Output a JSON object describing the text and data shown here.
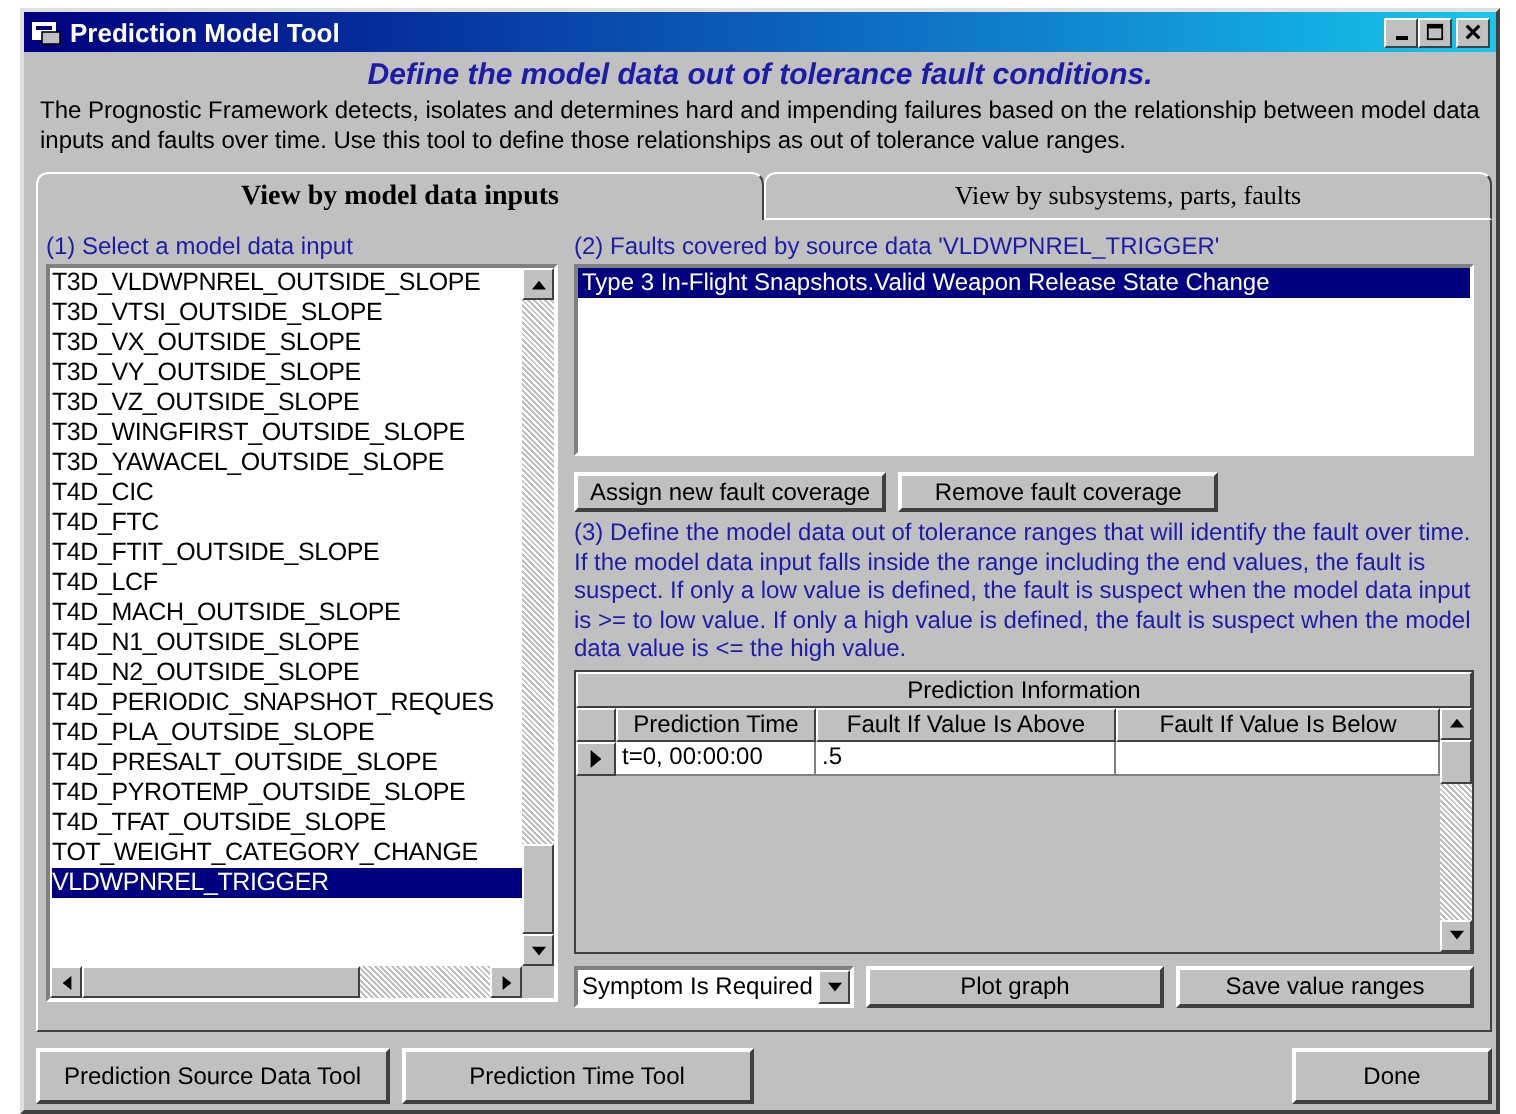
{
  "window": {
    "title": "Prediction Model Tool"
  },
  "heading": "Define the model data out of tolerance fault conditions.",
  "description": "The Prognostic Framework detects, isolates and determines hard and impending failures based on the relationship between model data inputs and faults over time.  Use this tool to define those relationships as out of tolerance value ranges.",
  "tabs": [
    {
      "label": "View by model data inputs",
      "selected": true
    },
    {
      "label": "View by subsystems, parts, faults",
      "selected": false
    }
  ],
  "inputs_panel": {
    "label": "(1) Select a model data input",
    "items": [
      {
        "label": "T3D_VLDWPNREL_OUTSIDE_SLOPE",
        "selected": false
      },
      {
        "label": "T3D_VTSI_OUTSIDE_SLOPE",
        "selected": false
      },
      {
        "label": "T3D_VX_OUTSIDE_SLOPE",
        "selected": false
      },
      {
        "label": "T3D_VY_OUTSIDE_SLOPE",
        "selected": false
      },
      {
        "label": "T3D_VZ_OUTSIDE_SLOPE",
        "selected": false
      },
      {
        "label": "T3D_WINGFIRST_OUTSIDE_SLOPE",
        "selected": false
      },
      {
        "label": "T3D_YAWACEL_OUTSIDE_SLOPE",
        "selected": false
      },
      {
        "label": "T4D_CIC",
        "selected": false
      },
      {
        "label": "T4D_FTC",
        "selected": false
      },
      {
        "label": "T4D_FTIT_OUTSIDE_SLOPE",
        "selected": false
      },
      {
        "label": "T4D_LCF",
        "selected": false
      },
      {
        "label": "T4D_MACH_OUTSIDE_SLOPE",
        "selected": false
      },
      {
        "label": "T4D_N1_OUTSIDE_SLOPE",
        "selected": false
      },
      {
        "label": "T4D_N2_OUTSIDE_SLOPE",
        "selected": false
      },
      {
        "label": "T4D_PERIODIC_SNAPSHOT_REQUES",
        "selected": false
      },
      {
        "label": "T4D_PLA_OUTSIDE_SLOPE",
        "selected": false
      },
      {
        "label": "T4D_PRESALT_OUTSIDE_SLOPE",
        "selected": false
      },
      {
        "label": "T4D_PYROTEMP_OUTSIDE_SLOPE",
        "selected": false
      },
      {
        "label": "T4D_TFAT_OUTSIDE_SLOPE",
        "selected": false
      },
      {
        "label": "TOT_WEIGHT_CATEGORY_CHANGE",
        "selected": false
      },
      {
        "label": "VLDWPNREL_TRIGGER",
        "selected": true
      }
    ]
  },
  "faults_panel": {
    "label": "(2) Faults covered by source data 'VLDWPNREL_TRIGGER'",
    "items": [
      {
        "label": "Type 3 In-Flight Snapshots.Valid Weapon Release State Change",
        "selected": true
      }
    ]
  },
  "coverage_buttons": [
    "Assign new fault coverage",
    "Remove fault coverage"
  ],
  "instructions": "(3) Define the model data out of tolerance ranges that will identify the fault over time.  If the model data input falls inside the range including the end values, the fault is suspect. If only a low value is defined, the fault is suspect when the model data input is >= to low value.  If only a high value is defined, the fault is suspect when the model data value is <= the high value.",
  "grid": {
    "title": "Prediction Information",
    "columns": [
      "Prediction Time",
      "Fault If Value Is Above",
      "Fault If Value Is Below"
    ],
    "rows": [
      {
        "current": true,
        "cells": [
          "t=0, 00:00:00",
          ".5",
          ""
        ]
      }
    ]
  },
  "symptom_dropdown": {
    "value": "Symptom Is Required"
  },
  "grid_buttons": [
    "Plot graph",
    "Save value ranges"
  ],
  "footer_buttons": [
    "Prediction Source Data Tool",
    "Prediction Time Tool",
    "Done"
  ]
}
